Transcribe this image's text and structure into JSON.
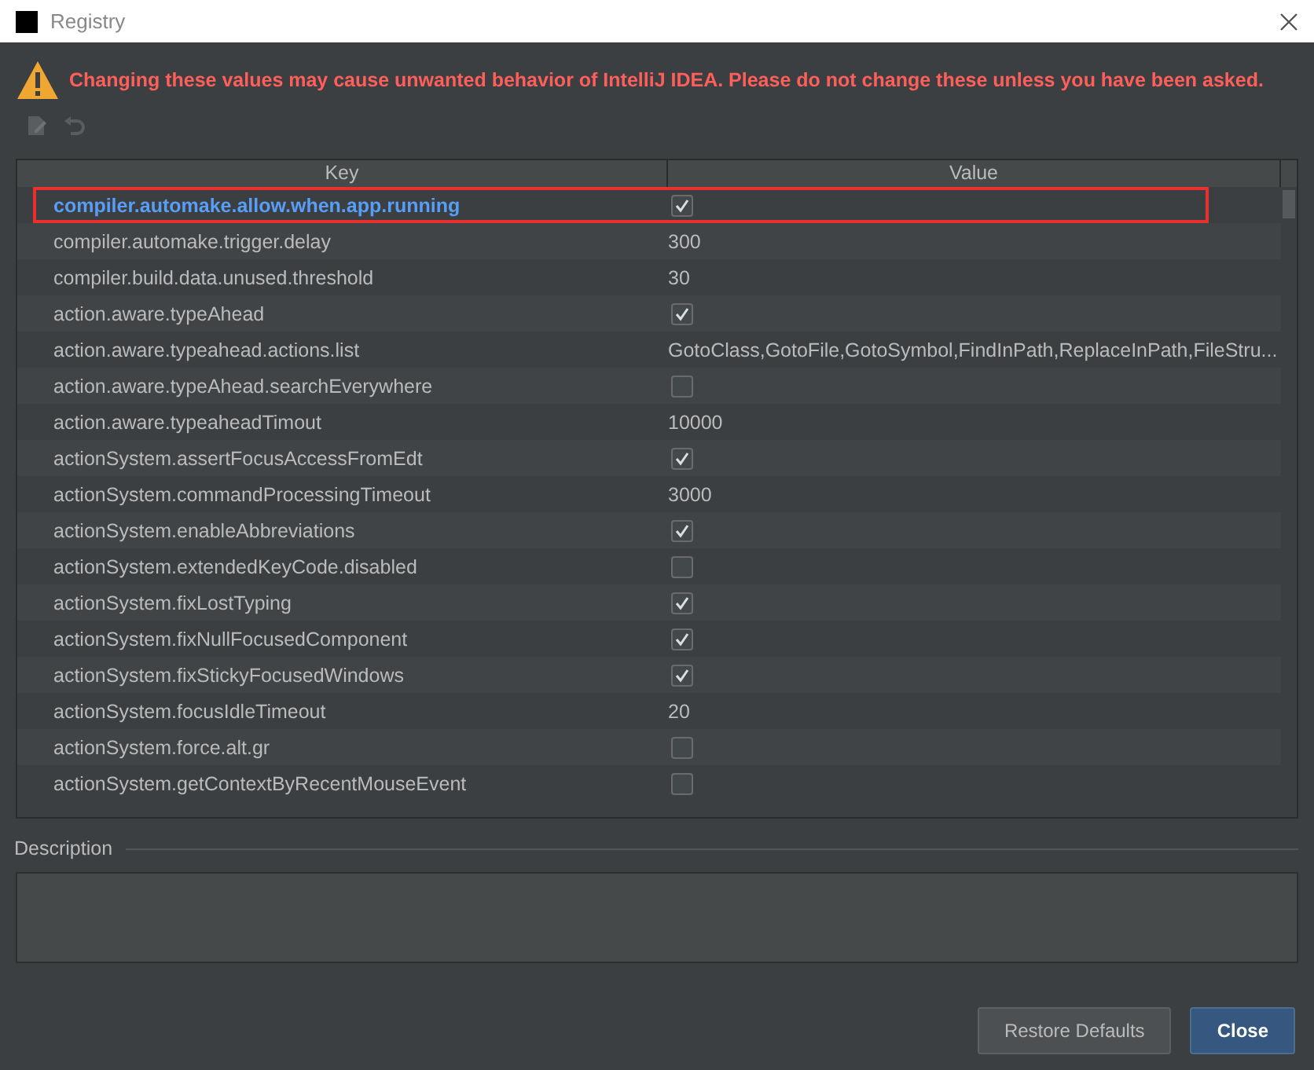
{
  "window": {
    "title": "Registry"
  },
  "warning": "Changing these values may cause unwanted behavior of IntelliJ IDEA. Please do not change these unless you have been asked.",
  "table": {
    "columns": [
      "Key",
      "Value"
    ],
    "rows": [
      {
        "key": "compiler.automake.allow.when.app.running",
        "kind": "checkbox",
        "checked": true,
        "modified": true,
        "highlighted": true
      },
      {
        "key": "compiler.automake.trigger.delay",
        "kind": "text",
        "value": "300",
        "modified": false,
        "highlighted": false
      },
      {
        "key": "compiler.build.data.unused.threshold",
        "kind": "text",
        "value": "30",
        "modified": false,
        "highlighted": false
      },
      {
        "key": "action.aware.typeAhead",
        "kind": "checkbox",
        "checked": true,
        "modified": false,
        "highlighted": false
      },
      {
        "key": "action.aware.typeahead.actions.list",
        "kind": "text",
        "value": "GotoClass,GotoFile,GotoSymbol,FindInPath,ReplaceInPath,FileStru...",
        "modified": false,
        "highlighted": false
      },
      {
        "key": "action.aware.typeAhead.searchEverywhere",
        "kind": "checkbox",
        "checked": false,
        "modified": false,
        "highlighted": false
      },
      {
        "key": "action.aware.typeaheadTimout",
        "kind": "text",
        "value": "10000",
        "modified": false,
        "highlighted": false
      },
      {
        "key": "actionSystem.assertFocusAccessFromEdt",
        "kind": "checkbox",
        "checked": true,
        "modified": false,
        "highlighted": false
      },
      {
        "key": "actionSystem.commandProcessingTimeout",
        "kind": "text",
        "value": "3000",
        "modified": false,
        "highlighted": false
      },
      {
        "key": "actionSystem.enableAbbreviations",
        "kind": "checkbox",
        "checked": true,
        "modified": false,
        "highlighted": false
      },
      {
        "key": "actionSystem.extendedKeyCode.disabled",
        "kind": "checkbox",
        "checked": false,
        "modified": false,
        "highlighted": false
      },
      {
        "key": "actionSystem.fixLostTyping",
        "kind": "checkbox",
        "checked": true,
        "modified": false,
        "highlighted": false
      },
      {
        "key": "actionSystem.fixNullFocusedComponent",
        "kind": "checkbox",
        "checked": true,
        "modified": false,
        "highlighted": false
      },
      {
        "key": "actionSystem.fixStickyFocusedWindows",
        "kind": "checkbox",
        "checked": true,
        "modified": false,
        "highlighted": false
      },
      {
        "key": "actionSystem.focusIdleTimeout",
        "kind": "text",
        "value": "20",
        "modified": false,
        "highlighted": false
      },
      {
        "key": "actionSystem.force.alt.gr",
        "kind": "checkbox",
        "checked": false,
        "modified": false,
        "highlighted": false
      },
      {
        "key": "actionSystem.getContextByRecentMouseEvent",
        "kind": "checkbox",
        "checked": false,
        "modified": false,
        "highlighted": false
      }
    ]
  },
  "description": {
    "label": "Description"
  },
  "buttons": [
    {
      "label": "Restore Defaults",
      "primary": false
    },
    {
      "label": "Close",
      "primary": true
    }
  ]
}
